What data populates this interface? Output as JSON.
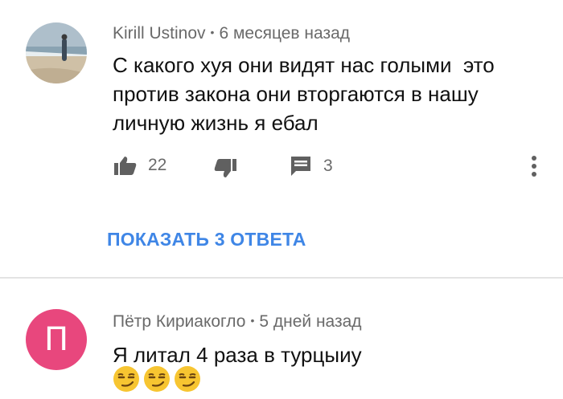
{
  "comments": [
    {
      "author": "Kirill Ustinov",
      "separator": "•",
      "time": "6 месяцев назад",
      "text_lines": [
        "С какого хуя они видят нас голыми  это",
        "против закона они вторгаются в нашу",
        "личную жизнь я ебал"
      ],
      "likes": "22",
      "replies_count": "3",
      "show_replies_label": "ПОКАЗАТЬ 3 ОТВЕТА",
      "avatar": "beach-photo"
    },
    {
      "author": "Пётр Кириакогло",
      "separator": "•",
      "time": "5 дней назад",
      "text_lines": [
        "Я литал 4 раза в турцыиу"
      ],
      "emoji": [
        "smirking-face",
        "smirking-face",
        "smirking-face"
      ],
      "avatar_letter": "П",
      "avatar_color": "#e8477d"
    }
  ],
  "icons": [
    "thumbs-up-icon",
    "thumbs-down-icon",
    "reply-icon",
    "more-vert-icon"
  ],
  "colors": {
    "link": "#3f86e6",
    "meta": "#6a6a6a",
    "text": "#111111"
  }
}
